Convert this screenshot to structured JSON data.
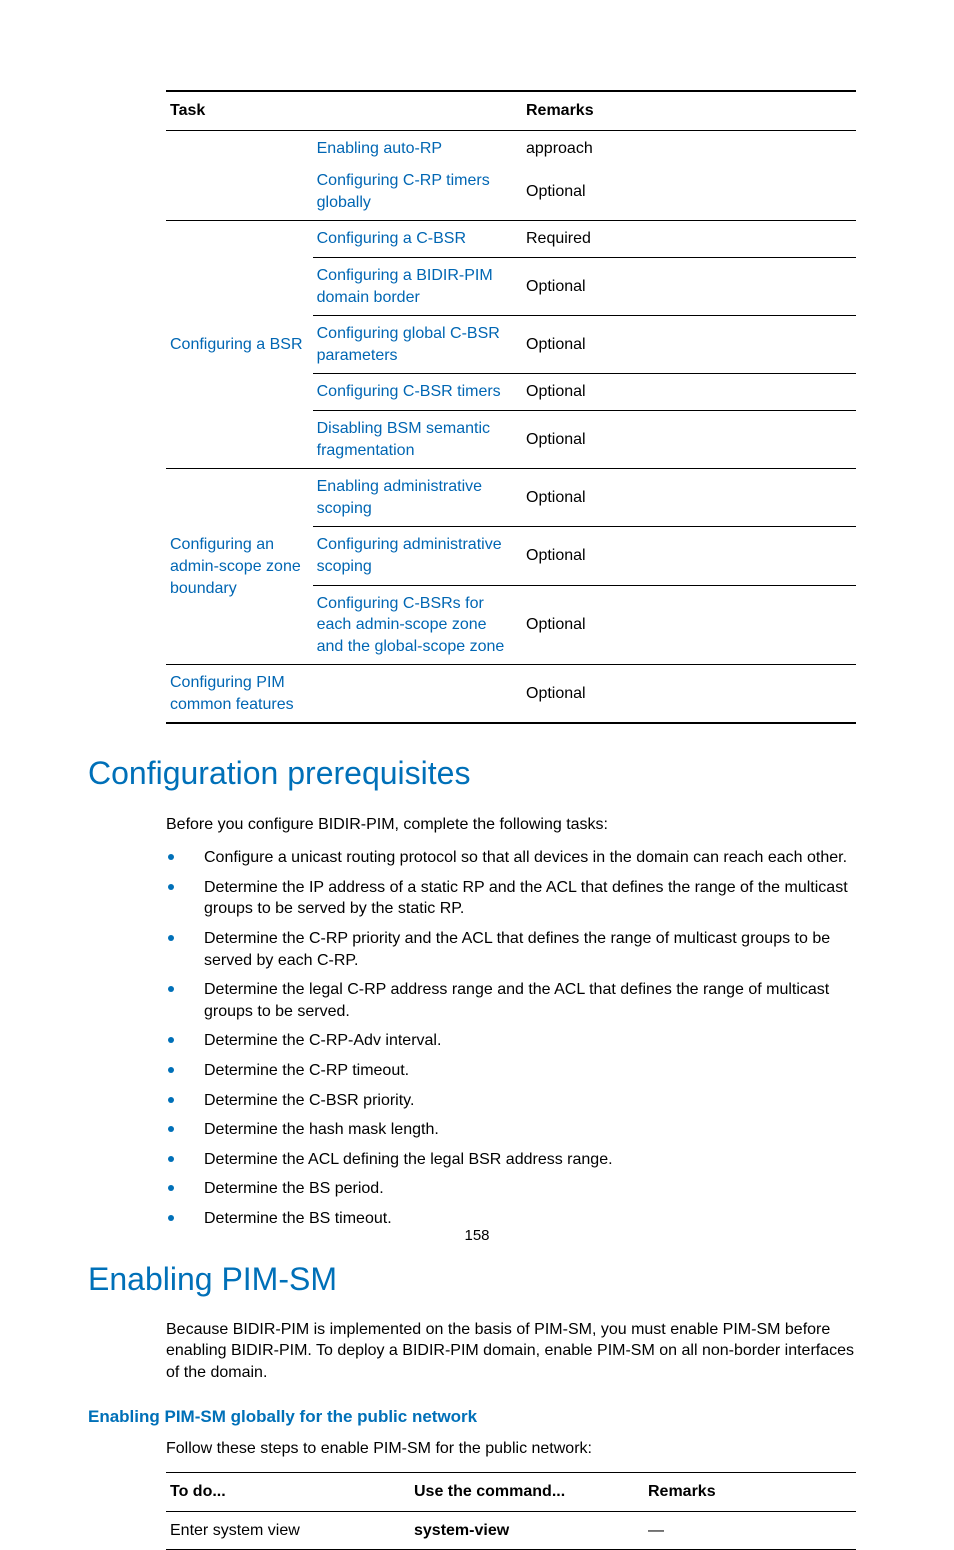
{
  "table1": {
    "headers": {
      "c1": "Task",
      "c2": "",
      "c3": "Remarks"
    },
    "rows": [
      {
        "cells": [
          "",
          "Enabling auto-RP",
          "approach"
        ],
        "linkCols": [
          1
        ],
        "cls": "noborder"
      },
      {
        "cells": [
          "",
          "Configuring C-RP timers globally",
          "Optional"
        ],
        "linkCols": [
          1
        ]
      },
      {
        "cells": [
          "Configuring a BSR",
          "Configuring a C-BSR",
          "Required"
        ],
        "linkCols": [
          0,
          1
        ],
        "rowspan0": 5
      },
      {
        "cells": [
          "Configuring a BIDIR-PIM domain border",
          "Optional"
        ],
        "linkCols": [
          0
        ]
      },
      {
        "cells": [
          "Configuring global C-BSR parameters",
          "Optional"
        ],
        "linkCols": [
          0
        ]
      },
      {
        "cells": [
          "Configuring C-BSR timers",
          "Optional"
        ],
        "linkCols": [
          0
        ]
      },
      {
        "cells": [
          "Disabling BSM semantic fragmentation",
          "Optional"
        ],
        "linkCols": [
          0
        ]
      },
      {
        "cells": [
          "Configuring an admin-scope zone boundary",
          "Enabling administrative scoping",
          "Optional"
        ],
        "linkCols": [
          0,
          1
        ],
        "rowspan0": 3
      },
      {
        "cells": [
          "Configuring administrative scoping",
          "Optional"
        ],
        "linkCols": [
          0
        ]
      },
      {
        "cells": [
          "Configuring C-BSRs for each admin-scope zone and the global-scope zone",
          "Optional"
        ],
        "linkCols": [
          0
        ]
      },
      {
        "cells": [
          "Configuring PIM common features",
          "",
          "Optional"
        ],
        "linkCols": [
          0
        ],
        "colspan1": 1,
        "cls": "lastrow"
      }
    ]
  },
  "section1": {
    "heading": "Configuration prerequisites",
    "intro": "Before you configure BIDIR-PIM, complete the following tasks:",
    "bullets": [
      "Configure a unicast routing protocol so that all devices in the domain can reach each other.",
      "Determine the IP address of a static RP and the ACL that defines the range of the multicast groups to be served by the static RP.",
      "Determine the C-RP priority and the ACL that defines the range of multicast groups to be served by each C-RP.",
      "Determine the legal C-RP address range and the ACL that defines the range of multicast groups to be served.",
      "Determine the C-RP-Adv interval.",
      "Determine the C-RP timeout.",
      "Determine the C-BSR priority.",
      "Determine the hash mask length.",
      "Determine the ACL defining the legal BSR address range.",
      "Determine the BS period.",
      "Determine the BS timeout."
    ]
  },
  "section2": {
    "heading": "Enabling PIM-SM",
    "para": "Because BIDIR-PIM is implemented on the basis of PIM-SM, you must enable PIM-SM before enabling BIDIR-PIM. To deploy a BIDIR-PIM domain, enable PIM-SM on all non-border interfaces of the domain.",
    "subheading": "Enabling PIM-SM globally for the public network",
    "intro2": "Follow these steps to enable PIM-SM for the public network:"
  },
  "table2": {
    "headers": {
      "c1": "To do...",
      "c2": "Use the command...",
      "c3": "Remarks"
    },
    "rows": [
      {
        "c1": "Enter system view",
        "c2": "system-view",
        "c3": "—",
        "boldCols": [
          "c2"
        ]
      }
    ]
  },
  "pageNumber": "158"
}
